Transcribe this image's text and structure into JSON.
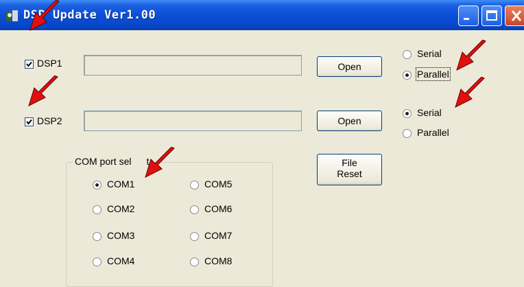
{
  "window": {
    "title": "DSP Update Ver1.00",
    "icon": "app-icon",
    "controls": [
      "minimize-icon",
      "maximize-icon",
      "close-icon"
    ]
  },
  "dsp1": {
    "label": "DSP1",
    "checked": true,
    "path_value": "",
    "open_label": "Open",
    "mode_options": [
      "Serial",
      "Parallel"
    ],
    "mode_selected": "Parallel"
  },
  "dsp2": {
    "label": "DSP2",
    "checked": true,
    "path_value": "",
    "open_label": "Open",
    "mode_options": [
      "Serial",
      "Parallel"
    ],
    "mode_selected": "Serial"
  },
  "file_reset": {
    "line1": "File",
    "line2": "Reset"
  },
  "com_group": {
    "title": "COM port sel",
    "title_tail": "t",
    "options": [
      "COM1",
      "COM2",
      "COM3",
      "COM4",
      "COM5",
      "COM6",
      "COM7",
      "COM8"
    ],
    "selected": "COM1"
  },
  "colors": {
    "titlebar": "#0a4fd8",
    "face": "#ece9d8",
    "annotation_arrow": "#e01010"
  }
}
